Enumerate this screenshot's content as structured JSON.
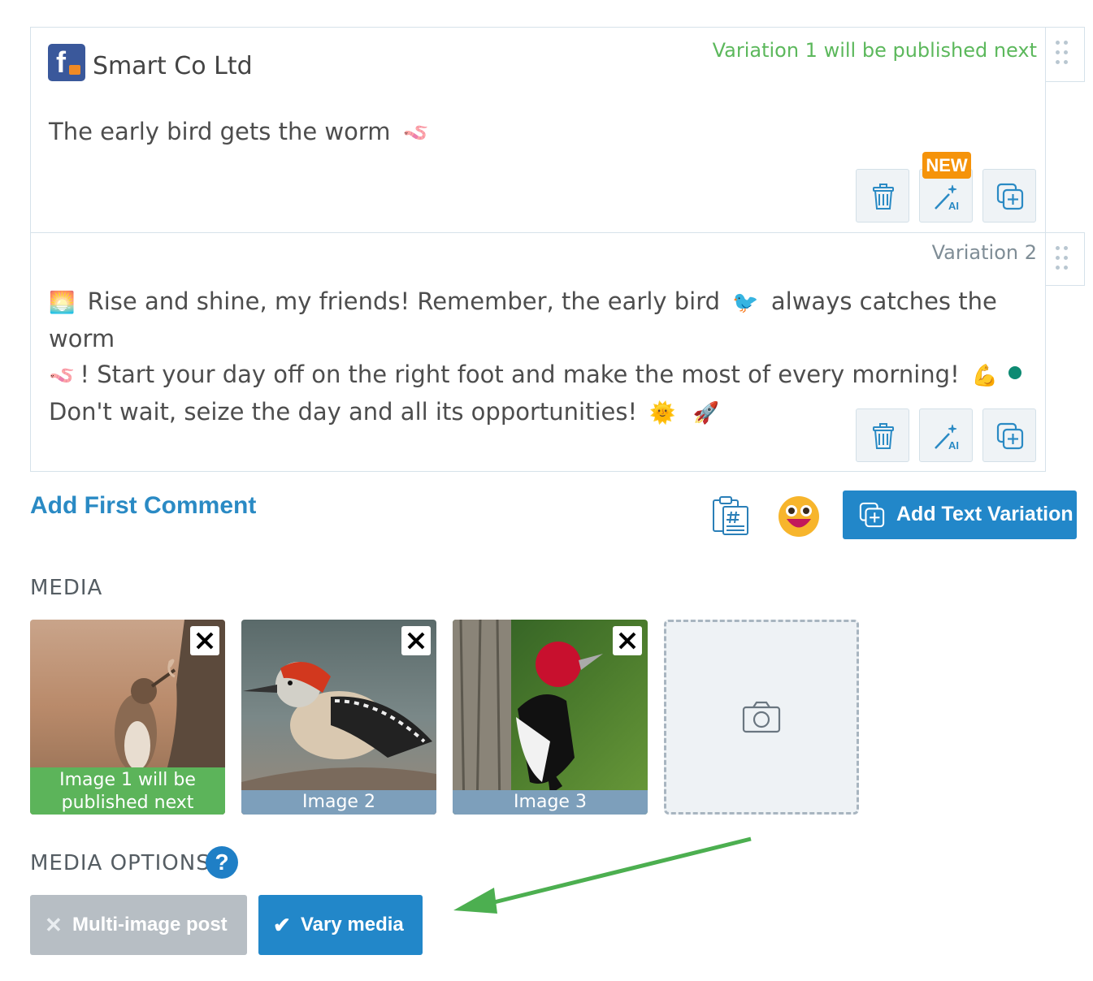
{
  "variations": [
    {
      "status_label": "Variation 1 will be published next",
      "account_name": "Smart Co Ltd",
      "text": "The early bird gets the worm",
      "text_emoji": "🪱"
    },
    {
      "status_label": "Variation 2",
      "line1_pre_emoji": "🌅",
      "line1": "Rise and shine, my friends! Remember, the early bird",
      "line1_emoji": "🐦",
      "line1_end": "always catches the worm",
      "line2_pre_emoji": "🪱",
      "line2": "! Start your day off on the right foot and make the most of every morning!",
      "line2_emoji": "💪",
      "line3": "Don't wait, seize the day and all its opportunities!",
      "line3_emoji_1": "🌞",
      "line3_emoji_2": "🚀"
    }
  ],
  "toolbar": {
    "new_badge": "NEW",
    "delete_icon": "trash-icon",
    "ai_icon": "magic-wand-ai-icon",
    "duplicate_icon": "duplicate-plus-icon"
  },
  "comment": {
    "add_first_comment": "Add First Comment",
    "add_text_variation": "Add Text Variation",
    "hashtag_icon": "hashtag-clipboard-icon",
    "emoji_icon": "grinning-face-icon"
  },
  "media": {
    "title": "MEDIA",
    "images": [
      {
        "caption_line1": "Image 1 will be",
        "caption_line2": "published next"
      },
      {
        "caption": "Image 2"
      },
      {
        "caption": "Image 3"
      }
    ],
    "upload_icon": "camera-icon"
  },
  "media_options": {
    "title": "MEDIA OPTIONS",
    "help": "?",
    "multi_image": "Multi-image post",
    "vary_media": "Vary media",
    "multi_icon": "✕",
    "vary_icon": "✔"
  },
  "colors": {
    "primary": "#2287c9",
    "success": "#5cb85c",
    "badge": "#f5930a",
    "disabled": "#b7bec4"
  }
}
